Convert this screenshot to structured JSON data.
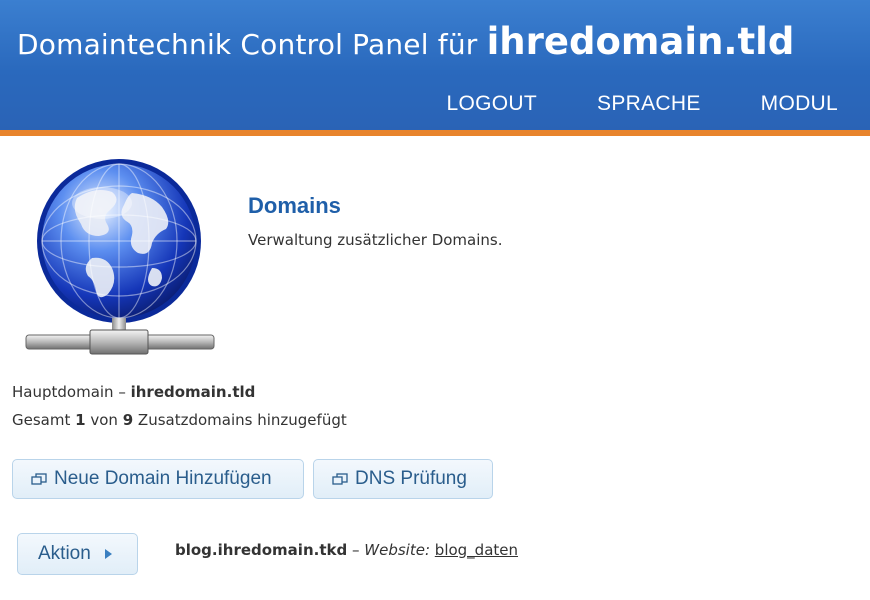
{
  "header": {
    "title_prefix": "Domaintechnik Control Panel für",
    "title_domain": "ihredomain.tld",
    "nav": [
      "LOGOUT",
      "SPRACHE",
      "MODUL"
    ]
  },
  "intro": {
    "title": "Domains",
    "description": "Verwaltung zusätzlicher Domains."
  },
  "stats": {
    "main_label": "Hauptdomain –",
    "main_domain": "ihredomain.tld",
    "total_prefix": "Gesamt",
    "total_count": "1",
    "total_mid": "von",
    "total_max": "9",
    "total_suffix": "Zusatzdomains hinzugefügt"
  },
  "buttons": {
    "add_domain": "Neue Domain Hinzufügen",
    "dns_check": "DNS Prüfung",
    "action": "Aktion"
  },
  "domains": [
    {
      "name": "blog.ihredomain.tkd",
      "sep": "–",
      "website_label": "Website:",
      "website_link": "blog_daten"
    }
  ],
  "colors": {
    "header_blue": "#2a69bd",
    "accent_orange": "#e8842c",
    "title_blue": "#1f5fa9"
  },
  "icons": {
    "globe": "network-globe-icon",
    "popup": "new-window-icon",
    "arrow": "triangle-right-icon"
  }
}
